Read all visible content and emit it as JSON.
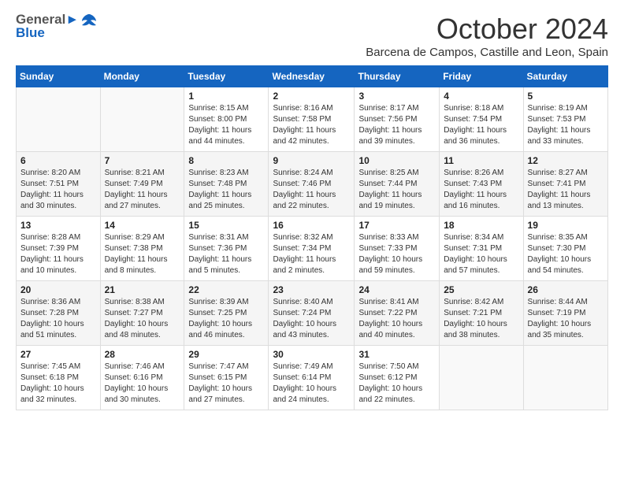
{
  "logo": {
    "line1": "General",
    "line2": "Blue"
  },
  "title": "October 2024",
  "location": "Barcena de Campos, Castille and Leon, Spain",
  "days_of_week": [
    "Sunday",
    "Monday",
    "Tuesday",
    "Wednesday",
    "Thursday",
    "Friday",
    "Saturday"
  ],
  "weeks": [
    [
      {
        "day": "",
        "info": ""
      },
      {
        "day": "",
        "info": ""
      },
      {
        "day": "1",
        "sunrise": "8:15 AM",
        "sunset": "8:00 PM",
        "daylight": "11 hours and 44 minutes."
      },
      {
        "day": "2",
        "sunrise": "8:16 AM",
        "sunset": "7:58 PM",
        "daylight": "11 hours and 42 minutes."
      },
      {
        "day": "3",
        "sunrise": "8:17 AM",
        "sunset": "7:56 PM",
        "daylight": "11 hours and 39 minutes."
      },
      {
        "day": "4",
        "sunrise": "8:18 AM",
        "sunset": "7:54 PM",
        "daylight": "11 hours and 36 minutes."
      },
      {
        "day": "5",
        "sunrise": "8:19 AM",
        "sunset": "7:53 PM",
        "daylight": "11 hours and 33 minutes."
      }
    ],
    [
      {
        "day": "6",
        "sunrise": "8:20 AM",
        "sunset": "7:51 PM",
        "daylight": "11 hours and 30 minutes."
      },
      {
        "day": "7",
        "sunrise": "8:21 AM",
        "sunset": "7:49 PM",
        "daylight": "11 hours and 27 minutes."
      },
      {
        "day": "8",
        "sunrise": "8:23 AM",
        "sunset": "7:48 PM",
        "daylight": "11 hours and 25 minutes."
      },
      {
        "day": "9",
        "sunrise": "8:24 AM",
        "sunset": "7:46 PM",
        "daylight": "11 hours and 22 minutes."
      },
      {
        "day": "10",
        "sunrise": "8:25 AM",
        "sunset": "7:44 PM",
        "daylight": "11 hours and 19 minutes."
      },
      {
        "day": "11",
        "sunrise": "8:26 AM",
        "sunset": "7:43 PM",
        "daylight": "11 hours and 16 minutes."
      },
      {
        "day": "12",
        "sunrise": "8:27 AM",
        "sunset": "7:41 PM",
        "daylight": "11 hours and 13 minutes."
      }
    ],
    [
      {
        "day": "13",
        "sunrise": "8:28 AM",
        "sunset": "7:39 PM",
        "daylight": "11 hours and 10 minutes."
      },
      {
        "day": "14",
        "sunrise": "8:29 AM",
        "sunset": "7:38 PM",
        "daylight": "11 hours and 8 minutes."
      },
      {
        "day": "15",
        "sunrise": "8:31 AM",
        "sunset": "7:36 PM",
        "daylight": "11 hours and 5 minutes."
      },
      {
        "day": "16",
        "sunrise": "8:32 AM",
        "sunset": "7:34 PM",
        "daylight": "11 hours and 2 minutes."
      },
      {
        "day": "17",
        "sunrise": "8:33 AM",
        "sunset": "7:33 PM",
        "daylight": "10 hours and 59 minutes."
      },
      {
        "day": "18",
        "sunrise": "8:34 AM",
        "sunset": "7:31 PM",
        "daylight": "10 hours and 57 minutes."
      },
      {
        "day": "19",
        "sunrise": "8:35 AM",
        "sunset": "7:30 PM",
        "daylight": "10 hours and 54 minutes."
      }
    ],
    [
      {
        "day": "20",
        "sunrise": "8:36 AM",
        "sunset": "7:28 PM",
        "daylight": "10 hours and 51 minutes."
      },
      {
        "day": "21",
        "sunrise": "8:38 AM",
        "sunset": "7:27 PM",
        "daylight": "10 hours and 48 minutes."
      },
      {
        "day": "22",
        "sunrise": "8:39 AM",
        "sunset": "7:25 PM",
        "daylight": "10 hours and 46 minutes."
      },
      {
        "day": "23",
        "sunrise": "8:40 AM",
        "sunset": "7:24 PM",
        "daylight": "10 hours and 43 minutes."
      },
      {
        "day": "24",
        "sunrise": "8:41 AM",
        "sunset": "7:22 PM",
        "daylight": "10 hours and 40 minutes."
      },
      {
        "day": "25",
        "sunrise": "8:42 AM",
        "sunset": "7:21 PM",
        "daylight": "10 hours and 38 minutes."
      },
      {
        "day": "26",
        "sunrise": "8:44 AM",
        "sunset": "7:19 PM",
        "daylight": "10 hours and 35 minutes."
      }
    ],
    [
      {
        "day": "27",
        "sunrise": "7:45 AM",
        "sunset": "6:18 PM",
        "daylight": "10 hours and 32 minutes."
      },
      {
        "day": "28",
        "sunrise": "7:46 AM",
        "sunset": "6:16 PM",
        "daylight": "10 hours and 30 minutes."
      },
      {
        "day": "29",
        "sunrise": "7:47 AM",
        "sunset": "6:15 PM",
        "daylight": "10 hours and 27 minutes."
      },
      {
        "day": "30",
        "sunrise": "7:49 AM",
        "sunset": "6:14 PM",
        "daylight": "10 hours and 24 minutes."
      },
      {
        "day": "31",
        "sunrise": "7:50 AM",
        "sunset": "6:12 PM",
        "daylight": "10 hours and 22 minutes."
      },
      {
        "day": "",
        "info": ""
      },
      {
        "day": "",
        "info": ""
      }
    ]
  ]
}
